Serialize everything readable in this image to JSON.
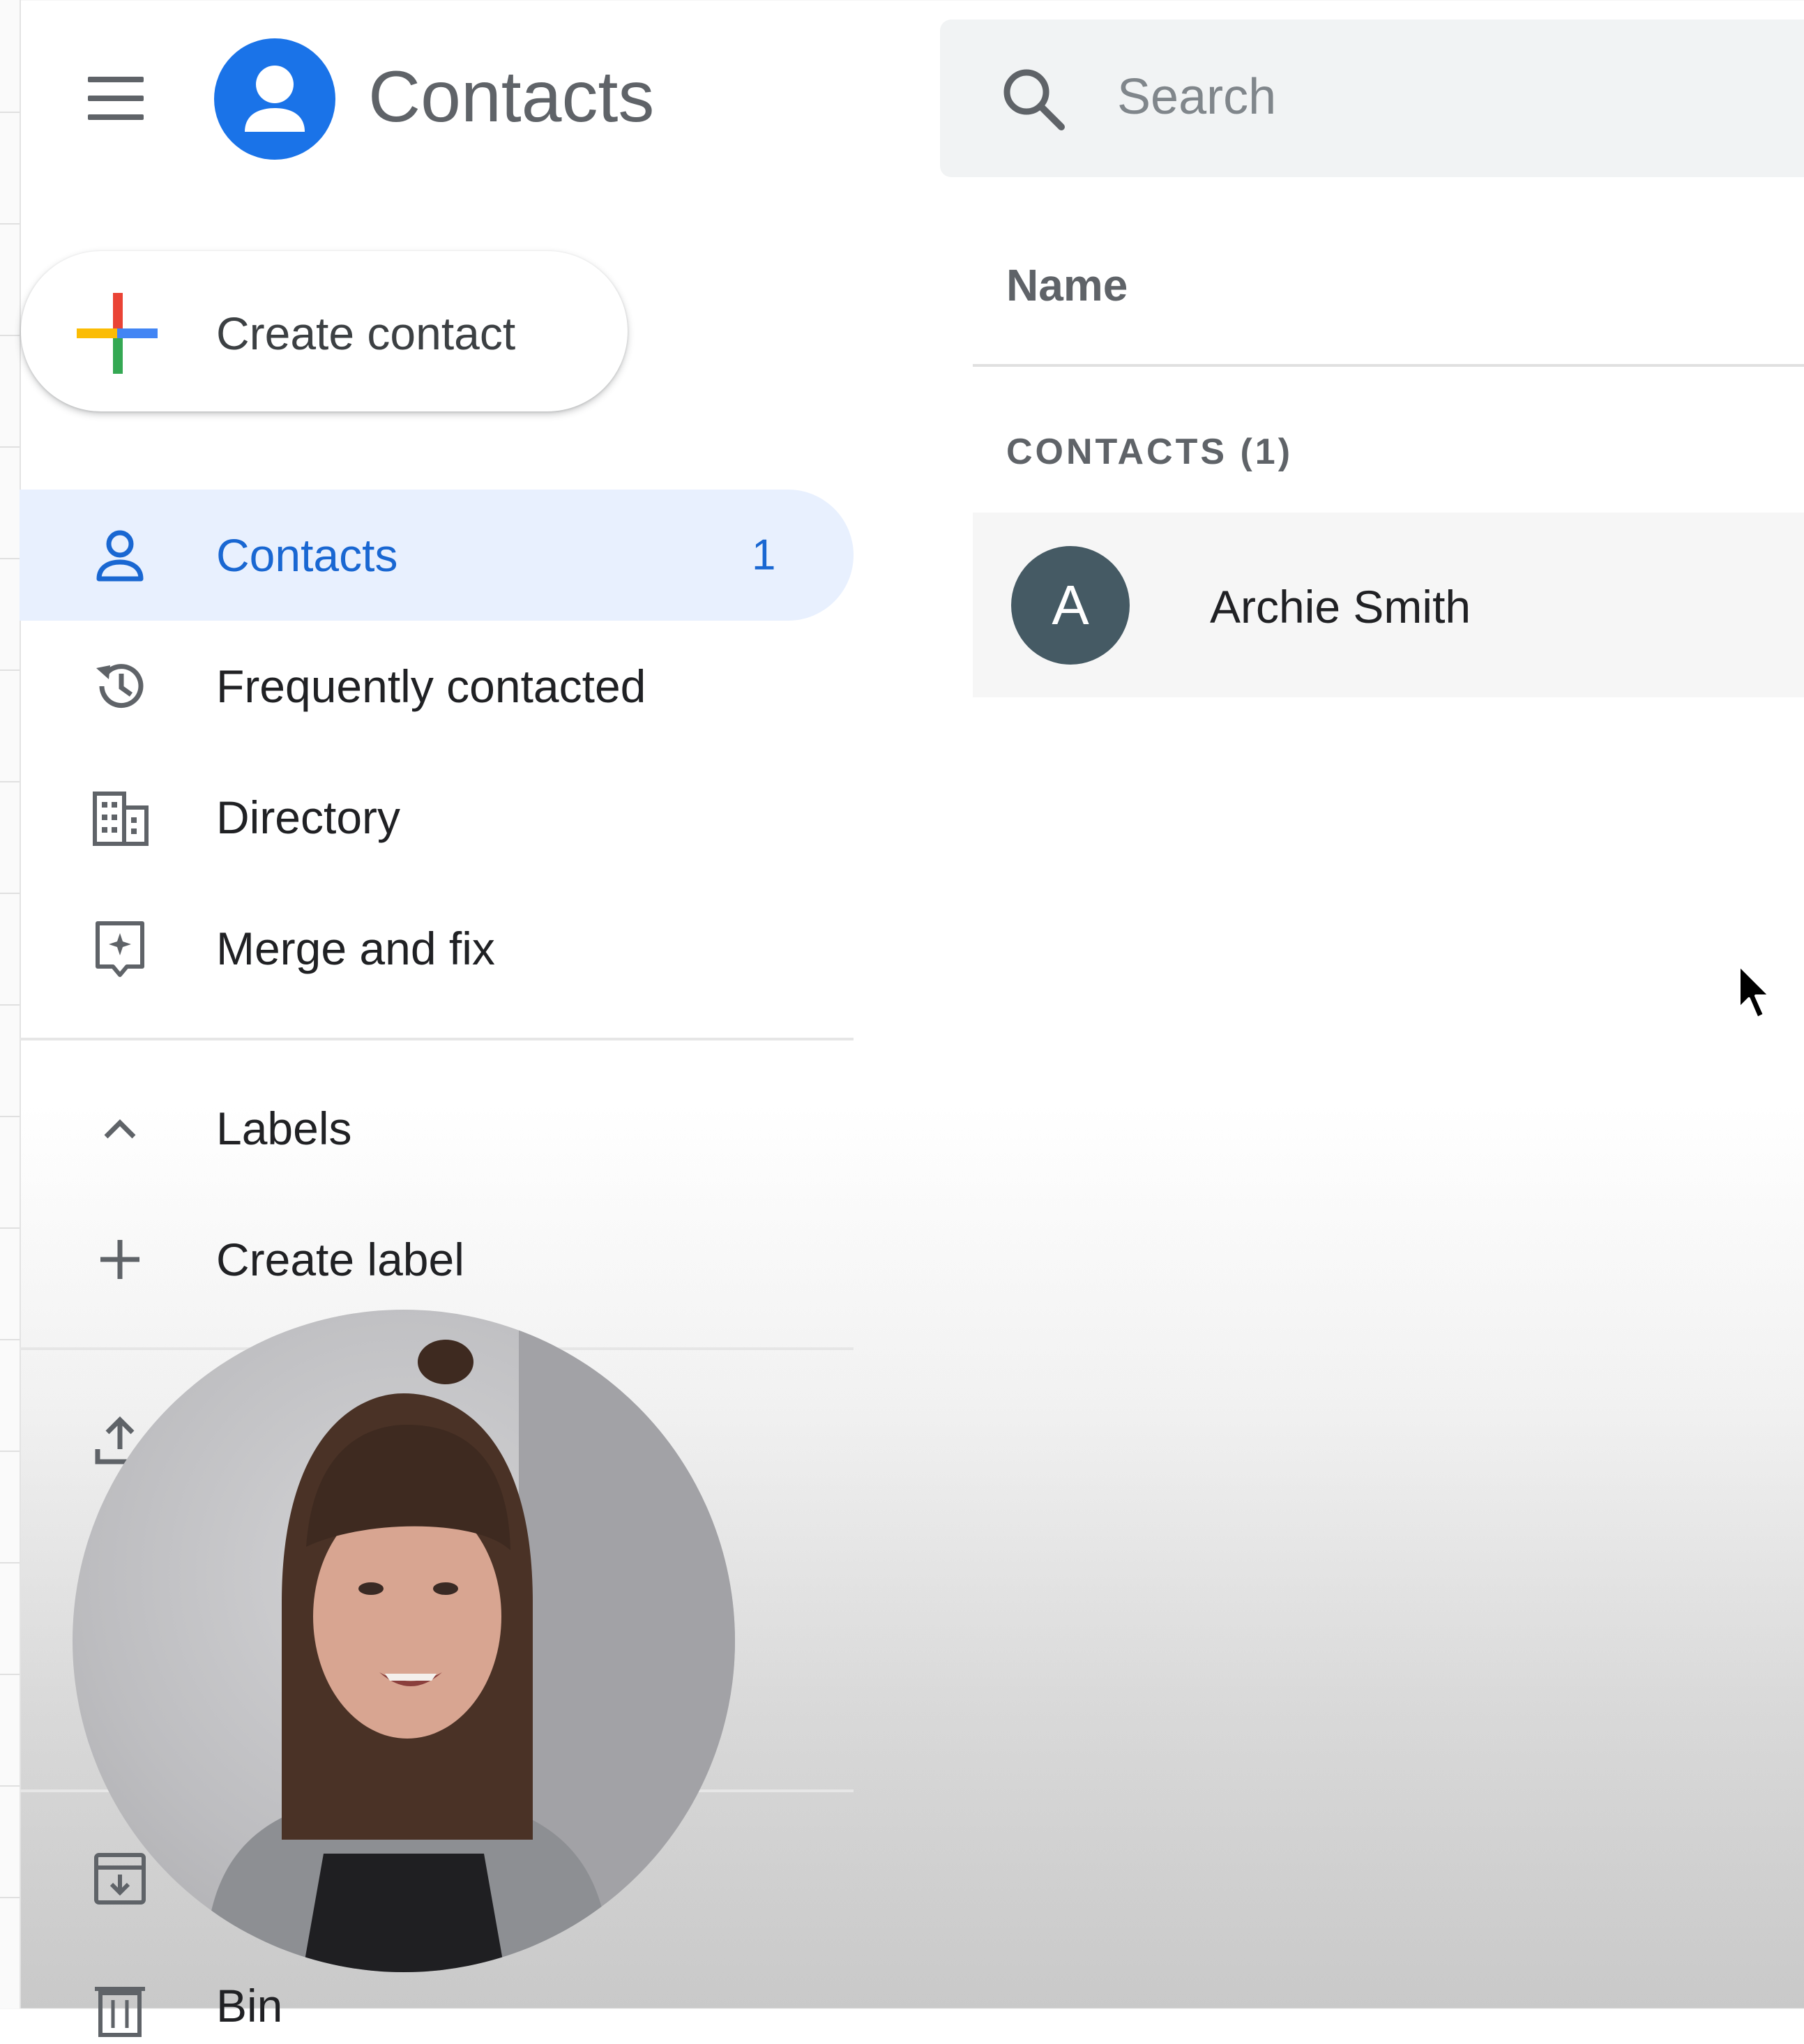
{
  "header": {
    "app_title": "Contacts",
    "logo_color": "#1a73e8"
  },
  "search": {
    "placeholder": "Search",
    "value": ""
  },
  "sidebar": {
    "create_contact_label": "Create contact",
    "items": [
      {
        "label": "Contacts",
        "icon": "person-icon",
        "count": "1",
        "active": true
      },
      {
        "label": "Frequently contacted",
        "icon": "history-icon"
      },
      {
        "label": "Directory",
        "icon": "building-icon"
      },
      {
        "label": "Merge and fix",
        "icon": "merge-icon"
      }
    ],
    "labels_section": {
      "title": "Labels",
      "create_label": "Create label"
    },
    "bottom_items": [
      {
        "icon": "import-icon"
      },
      {
        "icon": "archive-icon"
      },
      {
        "label": "Bin",
        "icon": "bin-icon"
      }
    ]
  },
  "list": {
    "column_header": "Name",
    "section_label": "CONTACTS (1)",
    "contacts": [
      {
        "initial": "A",
        "name": "Archie Smith",
        "avatar_color": "#455a64"
      }
    ]
  },
  "accent_color": "#1967d2",
  "active_bg_color": "#e8f0fe"
}
